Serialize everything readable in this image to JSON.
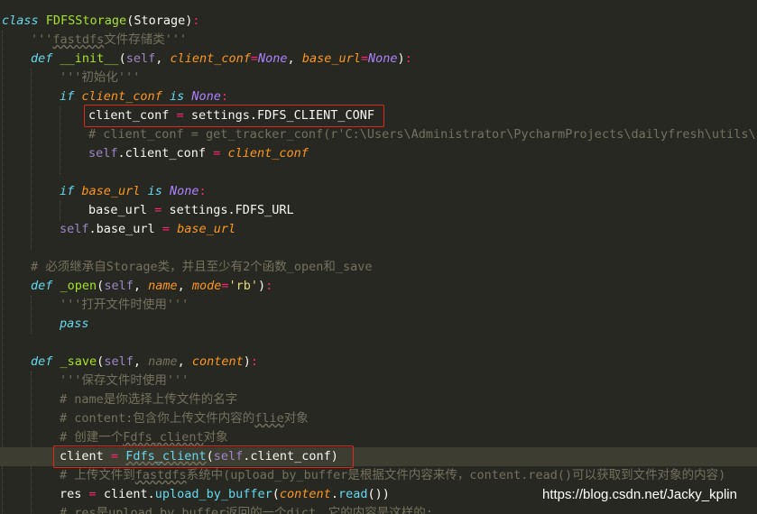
{
  "editor": {
    "theme_colors": {
      "background": "#272822",
      "keyword": "#66d9ef",
      "class_name": "#a6e22e",
      "self": "#9e86c8",
      "param": "#fd971f",
      "operator": "#f92672",
      "constant": "#ae81ff",
      "string": "#e6db74",
      "comment": "#75715e",
      "highlight_box": "#e0261c"
    },
    "lines": {
      "l1": {
        "a": "class",
        "b": "FDFSStorage",
        "c": "(Storage)",
        "d": ":"
      },
      "l2": {
        "a": "'''",
        "b": "fastdfs",
        "c": "文件存储类'''"
      },
      "l3": {
        "a": "def",
        "b": "__init__",
        "c": "(",
        "d": "self",
        "e": ", ",
        "f": "client_conf",
        "g": "=",
        "h": "None",
        "i": ", ",
        "j": "base_url",
        "k": "=",
        "l": "None",
        "m": ")",
        "n": ":"
      },
      "l4": {
        "a": "'''初始化'''"
      },
      "l5": {
        "a": "if",
        "b": "client_conf",
        "c": "is",
        "d": "None",
        "e": ":"
      },
      "l6": {
        "a": "client_conf",
        "b": "=",
        "c": "settings.FDFS_CLIENT_CONF"
      },
      "l7": {
        "a": "# client_conf = get_tracker_conf(r'C:\\Users\\Administrator\\PycharmProjects\\dailyfresh\\utils\\fd"
      },
      "l8": {
        "a": "self",
        "b": ".client_conf",
        "c": "=",
        "d": "client_conf"
      },
      "l10": {
        "a": "if",
        "b": "base_url",
        "c": "is",
        "d": "None",
        "e": ":"
      },
      "l11": {
        "a": "base_url",
        "b": "=",
        "c": "settings.FDFS_URL"
      },
      "l12": {
        "a": "self",
        "b": ".base_url",
        "c": "=",
        "d": "base_url"
      },
      "l14": {
        "a": "# 必须继承自Storage类，并且至少有2个函数_open和_save"
      },
      "l15": {
        "a": "def",
        "b": "_open",
        "c": "(",
        "d": "self",
        "e": ", ",
        "f": "name",
        "g": ", ",
        "h": "mode",
        "i": "=",
        "j": "'rb'",
        "k": ")",
        "l": ":"
      },
      "l16": {
        "a": "'''打开文件时使用'''"
      },
      "l17": {
        "a": "pass"
      },
      "l19": {
        "a": "def",
        "b": "_save",
        "c": "(",
        "d": "self",
        "e": ", ",
        "f": "name",
        "g": ", ",
        "h": "content",
        "i": ")",
        "j": ":"
      },
      "l20": {
        "a": "'''保存文件时使用'''"
      },
      "l21": {
        "a": "# name是你选择上传文件的名字"
      },
      "l22": {
        "a": "# content:包含你上传文件内容的",
        "b": "flie",
        "c": "对象"
      },
      "l23": {
        "a": "# 创建一个",
        "b": "Fdfs_client",
        "c": "对象"
      },
      "l24": {
        "a": "client",
        "b": "=",
        "c": "Fdfs_client",
        "d": "(",
        "e": "self",
        "f": ".client_conf)"
      },
      "l25": {
        "a": "# 上传文件到",
        "b": "fastdfs",
        "c": "系统中(upload_by_buffer是根据文件内容来传，content.read()可以获取到文件对象的内容)"
      },
      "l26": {
        "a": "res",
        "b": "=",
        "c": "client.",
        "d": "upload_by_buffer",
        "e": "(",
        "f": "content",
        "g": ".",
        "h": "read",
        "i": "())"
      },
      "l27": {
        "a": "# res是upload_by_buffer返回的一个dict，它的内容是这样的:"
      }
    }
  },
  "watermark": {
    "text": "https://blog.csdn.net/Jacky_kplin"
  }
}
